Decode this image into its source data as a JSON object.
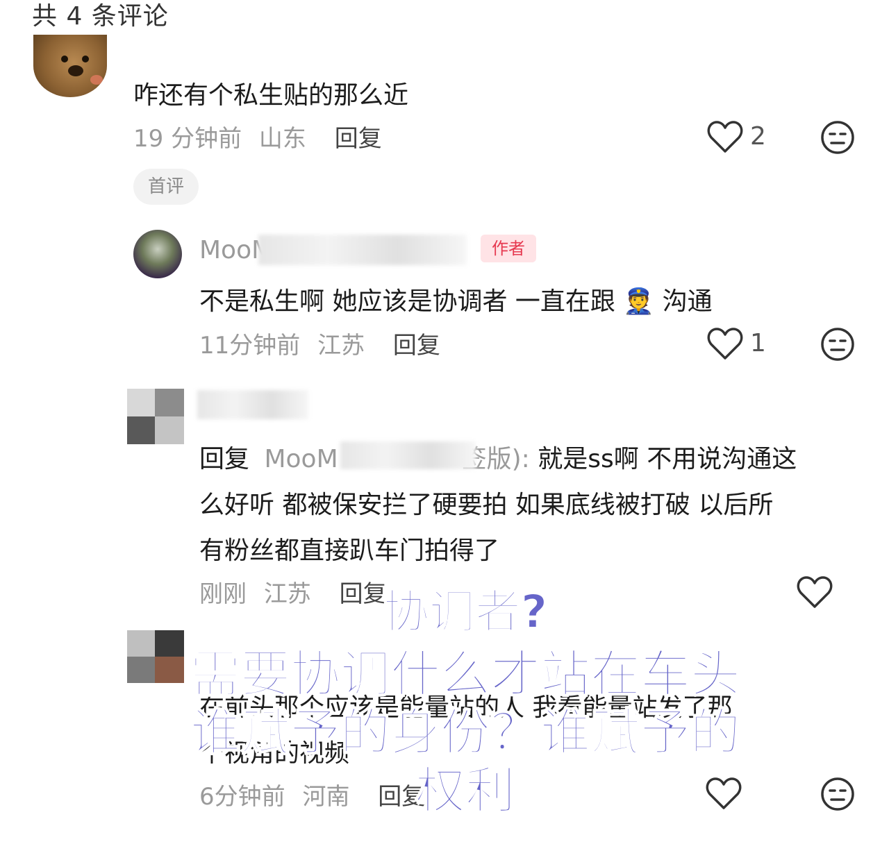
{
  "header": {
    "count_text": "共 4 条评论"
  },
  "comments": [
    {
      "text": "咋还有个私生贴的那么近",
      "time": "19 分钟前",
      "location": "山东",
      "reply_label": "回复",
      "likes": "2",
      "badge": "首评"
    },
    {
      "username": "MooM",
      "author_badge": "作者",
      "text": "不是私生啊 她应该是协调者 一直在跟 👮 沟通",
      "time": "11分钟前",
      "location": "江苏",
      "reply_label": "回复",
      "likes": "1"
    },
    {
      "reply_prefix": "回复",
      "reply_to": "MooM",
      "reply_to_suffix": "签版):",
      "line1": "就是ss啊 不用说沟通这",
      "line2": "么好听 都被保安拦了硬要拍 如果底线被打破 以后所",
      "line3": "有粉丝都直接趴车门拍得了",
      "time": "刚刚",
      "location": "江苏",
      "reply_label": "回复"
    },
    {
      "line1": "在前头那个应该是能量站的人 我看能量站发了那",
      "line2": "个视角的视频",
      "time": "6分钟前",
      "location": "河南",
      "reply_label": "回复"
    }
  ],
  "overlay": {
    "line1": "协调者?",
    "line2": "需要协调什么才站在车头",
    "line3": "谁赋予的身份？谁赋予的",
    "line4": "权利"
  },
  "colors": {
    "overlay_text": "#6665c9",
    "author_badge_bg": "#ffe3e6",
    "author_badge_text": "#e63950"
  },
  "icons": [
    "heart-icon",
    "dislike-face-icon"
  ]
}
